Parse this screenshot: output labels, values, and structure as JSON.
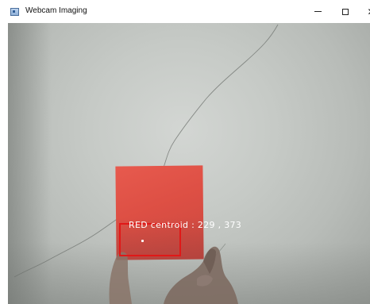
{
  "window": {
    "title": "Webcam Imaging",
    "icon": "app-window-icon",
    "controls": {
      "minimize": "–",
      "maximize": "☐",
      "close": "✕"
    }
  },
  "overlay": {
    "label": "RED centroid : 229 , 373",
    "box_color": "#e01818",
    "text_color": "#ffffff"
  },
  "colors": {
    "target_card": "#dd4f44",
    "background_wall": "#c6cac6"
  }
}
